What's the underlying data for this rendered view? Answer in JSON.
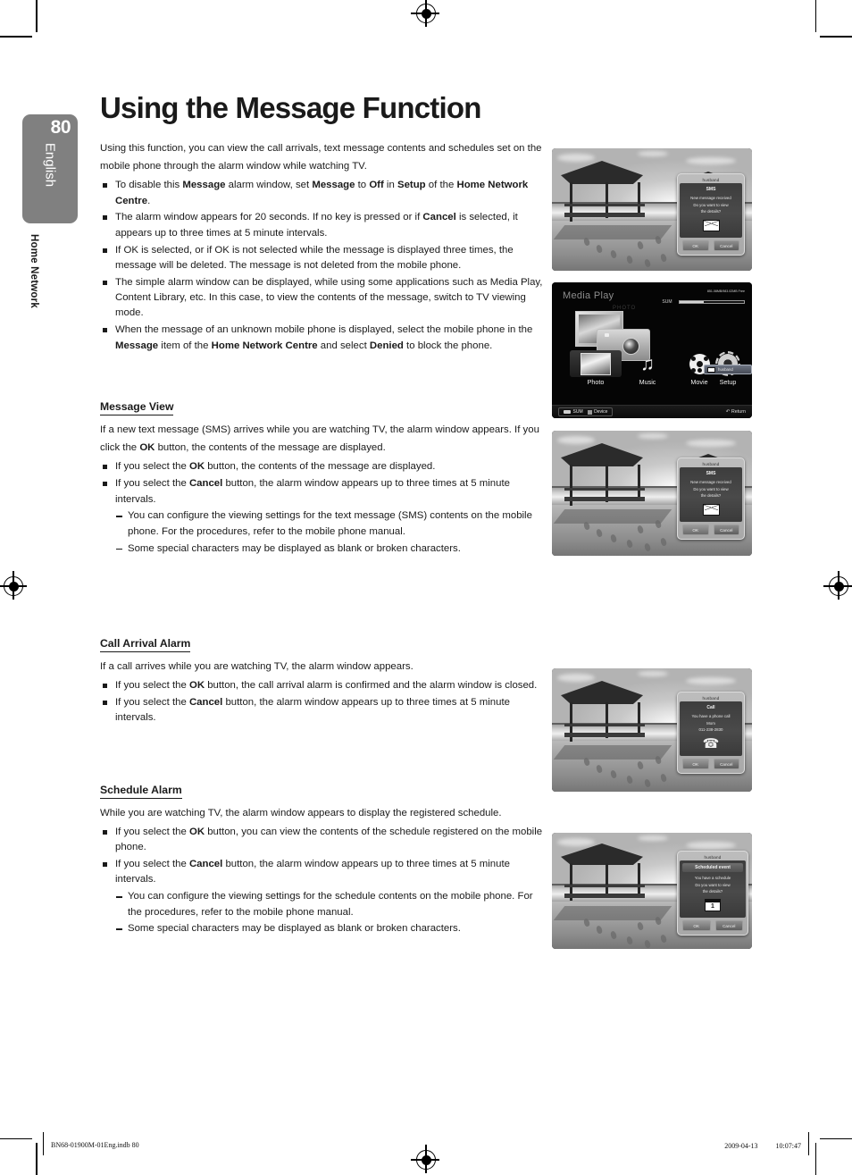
{
  "page": {
    "number": "80",
    "language": "English",
    "chapter": "Home Network"
  },
  "title": "Using the Message Function",
  "intro": "Using this function, you can view the call arrivals, text message contents and schedules set on the mobile phone through the alarm window while watching TV.",
  "intro_bullets": [
    "To disable this <b>Message</b> alarm window, set <b>Message</b> to <b>Off</b> in <b>Setup</b> of the <b>Home Network Centre</b>.",
    "The alarm window appears for 20 seconds. If no key is pressed or if <b>Cancel</b> is selected, it appears up to three times at 5 minute intervals.",
    "If OK is selected, or if OK is not selected while the message is displayed three times, the message will be deleted. The message is not deleted from the mobile phone.",
    "The simple alarm window can be displayed, while using some applications such as Media Play, Content Library, etc. In this case, to view the contents of the message, switch to TV viewing mode.",
    "When the message of an unknown mobile phone is displayed, select the mobile phone in the <b>Message</b> item of the <b>Home Network Centre</b> and select <b>Denied</b> to block the phone."
  ],
  "sections": [
    {
      "heading": "Message View",
      "body": "If a new text message (SMS) arrives while you are watching TV, the alarm window appears. If you click the <b>OK</b> button, the contents of the message are displayed.",
      "bullets": [
        "If you select the <b>OK</b> button, the contents of the message are displayed.",
        "If you select the <b>Cancel</b> button, the alarm window appears up to three times at 5 minute intervals."
      ],
      "dashes": [
        "You can configure the viewing settings for the text message (SMS) contents on the mobile phone. For the procedures, refer to the mobile phone manual.",
        "Some special characters may be displayed as blank or broken characters."
      ]
    },
    {
      "heading": "Call Arrival Alarm",
      "body": "If a call arrives while you are watching TV, the alarm window appears.",
      "bullets": [
        "If you select the <b>OK</b> button, the call arrival alarm is confirmed and the alarm window is closed.",
        "If you select the <b>Cancel</b> button, the alarm window appears up to three times at 5 minute intervals."
      ],
      "dashes": []
    },
    {
      "heading": "Schedule Alarm",
      "body": "While you are watching TV, the alarm window appears to display the registered schedule.",
      "bullets": [
        "If you select the <b>OK</b> button, you can view the contents of the schedule registered on the mobile phone.",
        "If you select the <b>Cancel</b> button, the alarm window appears up to three times at 5 minute intervals."
      ],
      "dashes": [
        "You can configure the viewing settings for the schedule contents on the mobile phone. For the procedures, refer to the mobile phone manual.",
        "Some special characters may be displayed as blank or broken characters."
      ]
    }
  ],
  "screenshots": {
    "sms": {
      "sender": "husband",
      "kind": "SMS",
      "line1": "New message received",
      "line2": "Do you want to view",
      "line3": "the details?",
      "icon": "envelope-icon",
      "ok": "OK",
      "cancel": "Cancel"
    },
    "media_play": {
      "title": "Media Play",
      "storage_label": "SUM",
      "storage_free": "851.08MB/983.02MB Free",
      "hero_label": "PHOTO",
      "items": [
        {
          "label": "Photo",
          "icon": "photo-icon"
        },
        {
          "label": "Music",
          "icon": "music-note-icon"
        },
        {
          "label": "Movie",
          "icon": "film-reel-icon"
        },
        {
          "label": "Setup",
          "icon": "gear-icon"
        }
      ],
      "notification": "husband",
      "key_usb": "SUM",
      "key_device": "Device",
      "key_return": "Return"
    },
    "sms2": {
      "sender": "husband",
      "kind": "SMS",
      "line1": "New message received",
      "line2": "Do you want to view",
      "line3": "the details?",
      "icon": "envelope-icon",
      "ok": "OK",
      "cancel": "Cancel"
    },
    "call": {
      "sender": "husband",
      "kind": "Call",
      "line1": "You have a phone call",
      "line2": "Mom",
      "line3": "011-238-2830",
      "icon": "phone-handset-icon",
      "ok": "OK",
      "cancel": "Cancel"
    },
    "schedule": {
      "sender": "husband",
      "kind": "Scheduled event",
      "line1": "You have a schedule",
      "line2": "Do you want to view",
      "line3": "the details?",
      "icon": "calendar-icon",
      "day": "1",
      "ok": "OK",
      "cancel": "Cancel"
    }
  },
  "footer": {
    "left": "BN68-01900M-01Eng.indb   80",
    "right": "2009-04-13   　　 10:07:47"
  },
  "colors": {
    "tab_gray": "#808080",
    "text": "#1a1a1a",
    "screen_black": "#050505"
  }
}
